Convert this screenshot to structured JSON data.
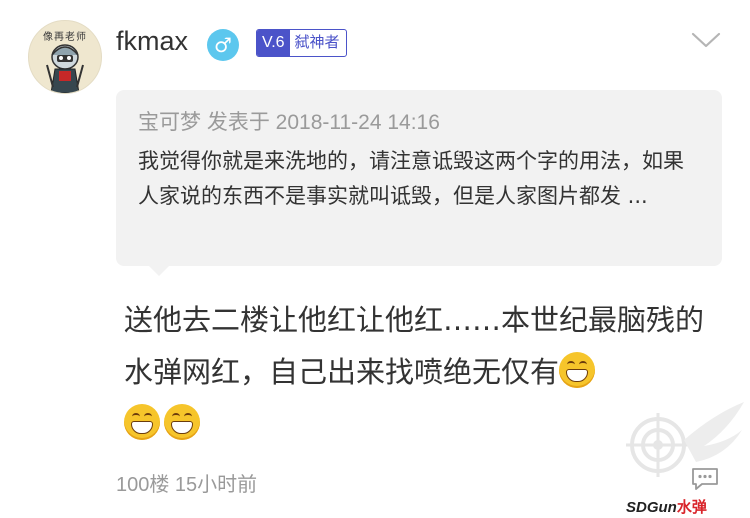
{
  "user": {
    "avatar_text": "像再老师",
    "name": "fkmax",
    "gender_icon": "male-icon",
    "gender_symbol": "♂",
    "level_tag": "V.6",
    "level_title": "弑神者"
  },
  "quote": {
    "meta": "宝可梦 发表于 2018-11-24 14:16",
    "text": "我觉得你就是来洗地的，请注意诋毁这两个字的用法，如果人家说的东西不是事实就叫诋毁，但是人家图片都发 ..."
  },
  "comment": {
    "text": "送他去二楼让他红让他红……本世纪最脑残的水弹网红，自己出来找喷绝无仅有"
  },
  "footer": {
    "meta": "100楼 15小时前"
  },
  "watermark": {
    "text_main": "SDGun",
    "text_accent": "水弹"
  },
  "colors": {
    "level_accent": "#4b53c9",
    "gender_bg": "#5cc7ee",
    "quote_bg": "#f2f2f2",
    "meta_gray": "#9a9a9a"
  }
}
